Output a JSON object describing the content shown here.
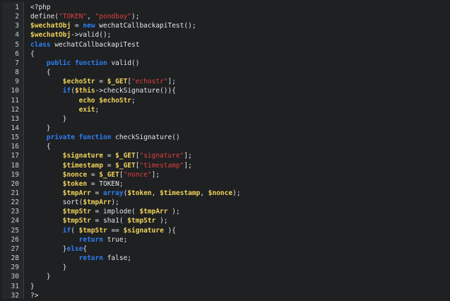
{
  "editor": {
    "lines": [
      {
        "n": "1",
        "tokens": [
          {
            "t": "<?php",
            "c": "plain"
          }
        ]
      },
      {
        "n": "2",
        "tokens": [
          {
            "t": "define(",
            "c": "plain"
          },
          {
            "t": "\"TOKEN\"",
            "c": "str"
          },
          {
            "t": ", ",
            "c": "plain"
          },
          {
            "t": "\"pondbay\"",
            "c": "str"
          },
          {
            "t": ");",
            "c": "plain"
          }
        ]
      },
      {
        "n": "3",
        "tokens": [
          {
            "t": "$wechatObj",
            "c": "var"
          },
          {
            "t": " = ",
            "c": "plain"
          },
          {
            "t": "new",
            "c": "kw"
          },
          {
            "t": " wechatCallbackapiTest();",
            "c": "plain"
          }
        ]
      },
      {
        "n": "4",
        "tokens": [
          {
            "t": "$wechatObj",
            "c": "var"
          },
          {
            "t": "->valid();",
            "c": "plain"
          }
        ]
      },
      {
        "n": "5",
        "tokens": [
          {
            "t": "class",
            "c": "kw"
          },
          {
            "t": " wechatCallbackapiTest",
            "c": "plain"
          }
        ]
      },
      {
        "n": "6",
        "tokens": [
          {
            "t": "{",
            "c": "plain"
          }
        ]
      },
      {
        "n": "7",
        "tokens": [
          {
            "t": "    ",
            "c": "plain"
          },
          {
            "t": "public",
            "c": "kw"
          },
          {
            "t": " ",
            "c": "plain"
          },
          {
            "t": "function",
            "c": "kw"
          },
          {
            "t": " valid()",
            "c": "plain"
          }
        ]
      },
      {
        "n": "8",
        "tokens": [
          {
            "t": "    {",
            "c": "plain"
          }
        ]
      },
      {
        "n": "9",
        "tokens": [
          {
            "t": "        ",
            "c": "plain"
          },
          {
            "t": "$echoStr",
            "c": "var"
          },
          {
            "t": " = ",
            "c": "plain"
          },
          {
            "t": "$_GET",
            "c": "var"
          },
          {
            "t": "[",
            "c": "plain"
          },
          {
            "t": "\"echostr\"",
            "c": "str"
          },
          {
            "t": "];",
            "c": "plain"
          }
        ]
      },
      {
        "n": "10",
        "tokens": [
          {
            "t": "        ",
            "c": "plain"
          },
          {
            "t": "if",
            "c": "kw"
          },
          {
            "t": "(",
            "c": "plain"
          },
          {
            "t": "$this",
            "c": "var"
          },
          {
            "t": "->checkSignature()){",
            "c": "plain"
          }
        ]
      },
      {
        "n": "11",
        "tokens": [
          {
            "t": "            ",
            "c": "plain"
          },
          {
            "t": "echo",
            "c": "kwy"
          },
          {
            "t": " ",
            "c": "plain"
          },
          {
            "t": "$echoStr",
            "c": "var"
          },
          {
            "t": ";",
            "c": "plain"
          }
        ]
      },
      {
        "n": "12",
        "tokens": [
          {
            "t": "            ",
            "c": "plain"
          },
          {
            "t": "exit",
            "c": "kwy"
          },
          {
            "t": ";",
            "c": "plain"
          }
        ]
      },
      {
        "n": "13",
        "tokens": [
          {
            "t": "        }",
            "c": "plain"
          }
        ]
      },
      {
        "n": "14",
        "tokens": [
          {
            "t": "    }",
            "c": "plain"
          }
        ]
      },
      {
        "n": "15",
        "tokens": [
          {
            "t": "    ",
            "c": "plain"
          },
          {
            "t": "private",
            "c": "kw"
          },
          {
            "t": " ",
            "c": "plain"
          },
          {
            "t": "function",
            "c": "kw"
          },
          {
            "t": " checkSignature()",
            "c": "plain"
          }
        ]
      },
      {
        "n": "16",
        "tokens": [
          {
            "t": "    {",
            "c": "plain"
          }
        ]
      },
      {
        "n": "17",
        "tokens": [
          {
            "t": "        ",
            "c": "plain"
          },
          {
            "t": "$signature",
            "c": "var"
          },
          {
            "t": " = ",
            "c": "plain"
          },
          {
            "t": "$_GET",
            "c": "var"
          },
          {
            "t": "[",
            "c": "plain"
          },
          {
            "t": "\"signature\"",
            "c": "str"
          },
          {
            "t": "];",
            "c": "plain"
          }
        ]
      },
      {
        "n": "18",
        "tokens": [
          {
            "t": "        ",
            "c": "plain"
          },
          {
            "t": "$timestamp",
            "c": "var"
          },
          {
            "t": " = ",
            "c": "plain"
          },
          {
            "t": "$_GET",
            "c": "var"
          },
          {
            "t": "[",
            "c": "plain"
          },
          {
            "t": "\"timestamp\"",
            "c": "str"
          },
          {
            "t": "];",
            "c": "plain"
          }
        ]
      },
      {
        "n": "19",
        "tokens": [
          {
            "t": "        ",
            "c": "plain"
          },
          {
            "t": "$nonce",
            "c": "var"
          },
          {
            "t": " = ",
            "c": "plain"
          },
          {
            "t": "$_GET",
            "c": "var"
          },
          {
            "t": "[",
            "c": "plain"
          },
          {
            "t": "\"nonce\"",
            "c": "str"
          },
          {
            "t": "];",
            "c": "plain"
          }
        ]
      },
      {
        "n": "20",
        "tokens": [
          {
            "t": "        ",
            "c": "plain"
          },
          {
            "t": "$token",
            "c": "var"
          },
          {
            "t": " = TOKEN;",
            "c": "plain"
          }
        ]
      },
      {
        "n": "21",
        "tokens": [
          {
            "t": "        ",
            "c": "plain"
          },
          {
            "t": "$tmpArr",
            "c": "var"
          },
          {
            "t": " = ",
            "c": "plain"
          },
          {
            "t": "array",
            "c": "kw"
          },
          {
            "t": "(",
            "c": "plain"
          },
          {
            "t": "$token",
            "c": "var"
          },
          {
            "t": ", ",
            "c": "plain"
          },
          {
            "t": "$timestamp",
            "c": "var"
          },
          {
            "t": ", ",
            "c": "plain"
          },
          {
            "t": "$nonce",
            "c": "var"
          },
          {
            "t": ");",
            "c": "plain"
          }
        ]
      },
      {
        "n": "22",
        "tokens": [
          {
            "t": "        sort(",
            "c": "plain"
          },
          {
            "t": "$tmpArr",
            "c": "var"
          },
          {
            "t": ");",
            "c": "plain"
          }
        ]
      },
      {
        "n": "23",
        "tokens": [
          {
            "t": "        ",
            "c": "plain"
          },
          {
            "t": "$tmpStr",
            "c": "var"
          },
          {
            "t": " = implode( ",
            "c": "plain"
          },
          {
            "t": "$tmpArr",
            "c": "var"
          },
          {
            "t": " );",
            "c": "plain"
          }
        ]
      },
      {
        "n": "24",
        "tokens": [
          {
            "t": "        ",
            "c": "plain"
          },
          {
            "t": "$tmpStr",
            "c": "var"
          },
          {
            "t": " = sha1( ",
            "c": "plain"
          },
          {
            "t": "$tmpStr",
            "c": "var"
          },
          {
            "t": " );",
            "c": "plain"
          }
        ]
      },
      {
        "n": "25",
        "tokens": [
          {
            "t": "        ",
            "c": "plain"
          },
          {
            "t": "if",
            "c": "kw"
          },
          {
            "t": "( ",
            "c": "plain"
          },
          {
            "t": "$tmpStr",
            "c": "var"
          },
          {
            "t": " == ",
            "c": "plain"
          },
          {
            "t": "$signature",
            "c": "var"
          },
          {
            "t": " ){",
            "c": "plain"
          }
        ]
      },
      {
        "n": "26",
        "tokens": [
          {
            "t": "            ",
            "c": "plain"
          },
          {
            "t": "return",
            "c": "kw"
          },
          {
            "t": " true;",
            "c": "plain"
          }
        ]
      },
      {
        "n": "27",
        "tokens": [
          {
            "t": "        }",
            "c": "plain"
          },
          {
            "t": "else",
            "c": "kw"
          },
          {
            "t": "{",
            "c": "plain"
          }
        ]
      },
      {
        "n": "28",
        "tokens": [
          {
            "t": "            ",
            "c": "plain"
          },
          {
            "t": "return",
            "c": "kw"
          },
          {
            "t": " false;",
            "c": "plain"
          }
        ]
      },
      {
        "n": "29",
        "tokens": [
          {
            "t": "        }",
            "c": "plain"
          }
        ]
      },
      {
        "n": "30",
        "tokens": [
          {
            "t": "    }",
            "c": "plain"
          }
        ]
      },
      {
        "n": "31",
        "tokens": [
          {
            "t": "}",
            "c": "plain"
          }
        ]
      },
      {
        "n": "32",
        "tokens": [
          {
            "t": "?>",
            "c": "plain"
          }
        ]
      }
    ]
  },
  "colors": {
    "background": "#1e2022",
    "gutter": "#25282b",
    "keyword": "#2f7ff5",
    "variable": "#f0d25a",
    "string": "#e04040",
    "plain": "#e6e6e6",
    "line_number": "#c8ccd0"
  }
}
